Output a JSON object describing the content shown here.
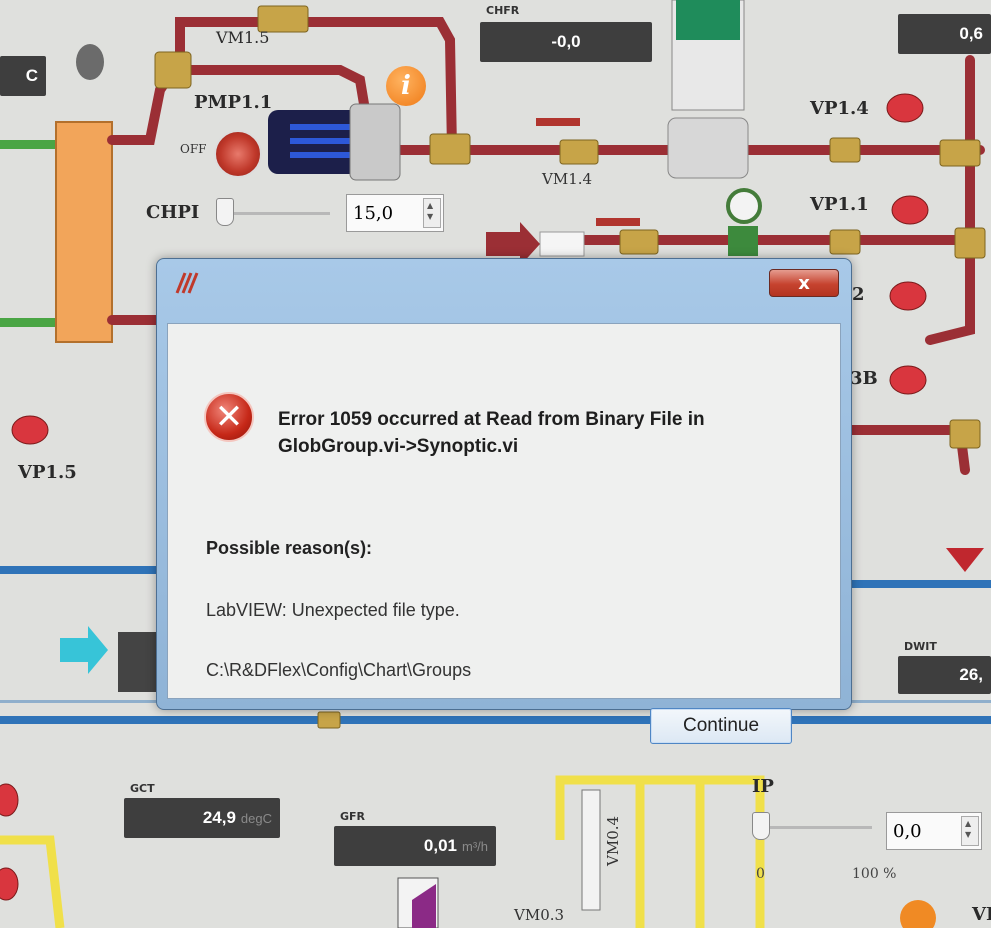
{
  "labels": {
    "vm15": "VM1.5",
    "pmp": "PMP1.1",
    "off": "OFF",
    "vm14": "VM1.4",
    "vp14": "VP1.4",
    "vp11": "VP1.1",
    "chpi": "CHPI",
    "vp15": "VP1.5",
    "vm04": "VM0.4",
    "vm03": "VM0.3",
    "ip": "IP",
    "vp12_partial": "2",
    "vp13_partial": "3B",
    "vi_partial": "VI"
  },
  "indicators": {
    "chfr": {
      "tag": "CHFR",
      "value": "-0,0"
    },
    "top_right": {
      "value": "0,6"
    },
    "dwit": {
      "tag": "DWIT",
      "value": "26,"
    },
    "gct": {
      "tag": "GCT",
      "value": "24,9",
      "unit": "degC"
    },
    "gfr": {
      "tag": "GFR",
      "value": "0,01",
      "unit": "m³/h"
    },
    "left_unit": {
      "value": "C"
    }
  },
  "controls": {
    "chpi_value": "15,0",
    "ip_value": "0,0",
    "ip_tick_min": "0",
    "ip_tick_max": "100 %"
  },
  "dialog": {
    "title": "Error 1059 occurred at Read from Binary File in GlobGroup.vi->Synoptic.vi",
    "close_label": "x",
    "reasons_heading": "Possible reason(s):",
    "reason_text": "LabVIEW:  Unexpected file type.",
    "path": "C:\\R&DFlex\\Config\\Chart\\Groups",
    "continue_label": "Continue"
  },
  "colors": {
    "pipe_red": "#9b2f35",
    "pipe_blue": "#2f73b8",
    "pipe_green": "#4aa544",
    "pipe_yellow": "#f0e04a",
    "valve_red": "#d9363e",
    "dialog_frame": "#9fc0e2"
  }
}
